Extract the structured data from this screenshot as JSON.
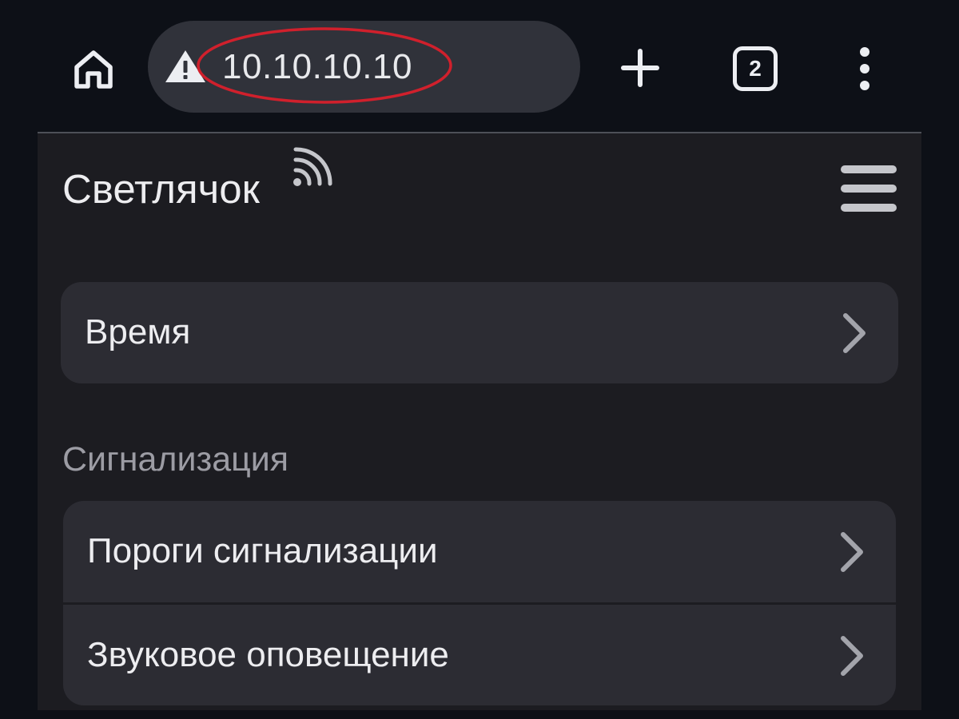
{
  "browser": {
    "url": "10.10.10.10",
    "tab_count": "2",
    "icons": {
      "home": "home-icon",
      "warning": "warning-triangle-icon",
      "new_tab": "plus-icon",
      "tabs": "tab-switcher-icon",
      "menu": "more-vertical-icon"
    },
    "highlight_color": "#d0202c"
  },
  "page": {
    "title": "Светлячок",
    "title_icon": "wifi-icon",
    "menu_icon": "hamburger-icon",
    "items": [
      {
        "label": "Время"
      }
    ],
    "sections": [
      {
        "heading": "Сигнализация",
        "items": [
          {
            "label": "Пороги сигнализации"
          },
          {
            "label": "Звуковое оповещение"
          }
        ]
      }
    ],
    "chevron_icon": "chevron-right-icon"
  }
}
